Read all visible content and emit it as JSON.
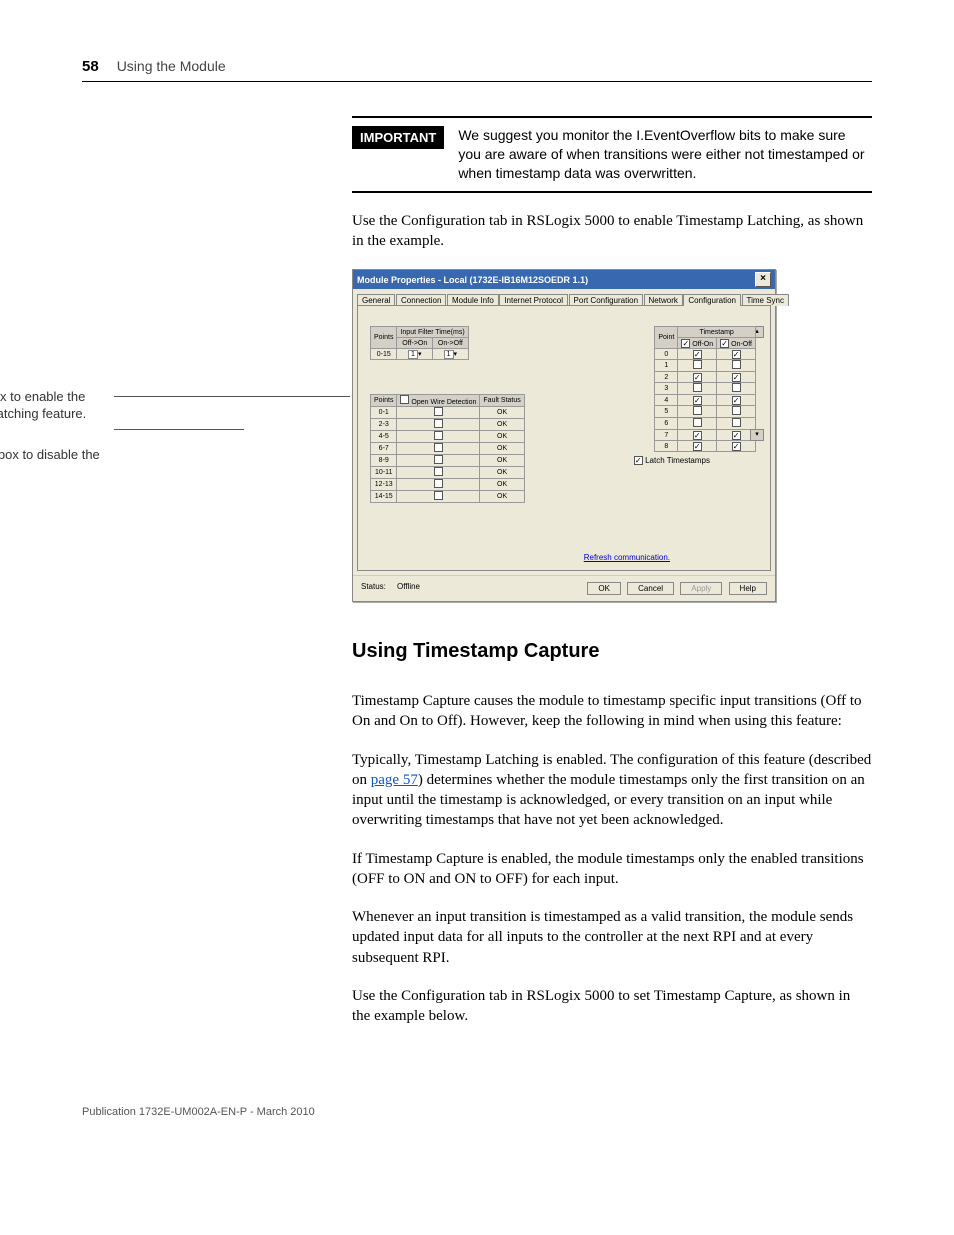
{
  "page_number": "58",
  "chapter_title": "Using the Module",
  "important": {
    "label": "IMPORTANT",
    "text": "We suggest you monitor the I.EventOverflow bits to make sure you are aware of when transitions were either not timestamped or when timestamp data was overwritten."
  },
  "para1": "Use the Configuration tab in RSLogix 5000 to enable Timestamp Latching, as shown in the example.",
  "annotation1": "Select this box to enable the Timestamp Latching feature.",
  "annotation2": "Deselect the box to disable the feature.",
  "dialog": {
    "title": "Module Properties - Local (1732E-IB16M12SOEDR 1.1)",
    "tabs": [
      "General",
      "Connection",
      "Module Info",
      "Internet Protocol",
      "Port Configuration",
      "Network",
      "Configuration",
      "Time Sync"
    ],
    "active_tab": "Configuration",
    "filter_table": {
      "headers": [
        "Points",
        "Input Filter Time(ms)"
      ],
      "sub_headers": [
        "Off->On",
        "On->Off"
      ],
      "row_label": "0-15",
      "val1": "1",
      "val2": "1"
    },
    "fault_table": {
      "headers": [
        "Points",
        "Open Wire Detection",
        "Fault Status"
      ],
      "rows": [
        {
          "p": "0-1",
          "ow": false,
          "fs": "OK"
        },
        {
          "p": "2-3",
          "ow": false,
          "fs": "OK"
        },
        {
          "p": "4-5",
          "ow": false,
          "fs": "OK"
        },
        {
          "p": "6-7",
          "ow": false,
          "fs": "OK"
        },
        {
          "p": "8-9",
          "ow": false,
          "fs": "OK"
        },
        {
          "p": "10-11",
          "ow": false,
          "fs": "OK"
        },
        {
          "p": "12-13",
          "ow": false,
          "fs": "OK"
        },
        {
          "p": "14-15",
          "ow": false,
          "fs": "OK"
        }
      ]
    },
    "timestamp_table": {
      "headers": [
        "Point",
        "Timestamp"
      ],
      "sub_headers": [
        "Off-On",
        "On-Off"
      ],
      "rows": [
        {
          "p": "0",
          "a": true,
          "b": true
        },
        {
          "p": "1",
          "a": false,
          "b": false
        },
        {
          "p": "2",
          "a": true,
          "b": true
        },
        {
          "p": "3",
          "a": false,
          "b": false
        },
        {
          "p": "4",
          "a": true,
          "b": true
        },
        {
          "p": "5",
          "a": false,
          "b": false
        },
        {
          "p": "6",
          "a": false,
          "b": false
        },
        {
          "p": "7",
          "a": true,
          "b": true
        },
        {
          "p": "8",
          "a": true,
          "b": true
        }
      ]
    },
    "latch_label": "Latch Timestamps",
    "latch_checked": true,
    "refresh_label": "Refresh communication.",
    "status_label": "Status:",
    "status_value": "Offline",
    "buttons": {
      "ok": "OK",
      "cancel": "Cancel",
      "apply": "Apply",
      "help": "Help"
    }
  },
  "section_title": "Using Timestamp Capture",
  "para2": "Timestamp Capture causes the module to timestamp specific input transitions (Off to On and On to Off). However, keep the following in mind when using this feature:",
  "para3a": "Typically, Timestamp Latching is enabled. The configuration of this feature (described on ",
  "page_link": "page 57",
  "para3b": ") determines whether the module timestamps only the first transition on an input until the timestamp is acknowledged, or every transition on an input while overwriting timestamps that have not yet been acknowledged.",
  "para4": "If Timestamp Capture is enabled, the module timestamps only the enabled transitions (OFF to ON and ON to OFF) for each input.",
  "para5": "Whenever an input transition is timestamped as a valid transition, the module sends updated input data for all inputs to the controller at the next RPI and at every subsequent RPI.",
  "para6": "Use the Configuration tab in RSLogix 5000 to set Timestamp Capture, as shown in the example below.",
  "footer": "Publication 1732E-UM002A-EN-P - March 2010"
}
